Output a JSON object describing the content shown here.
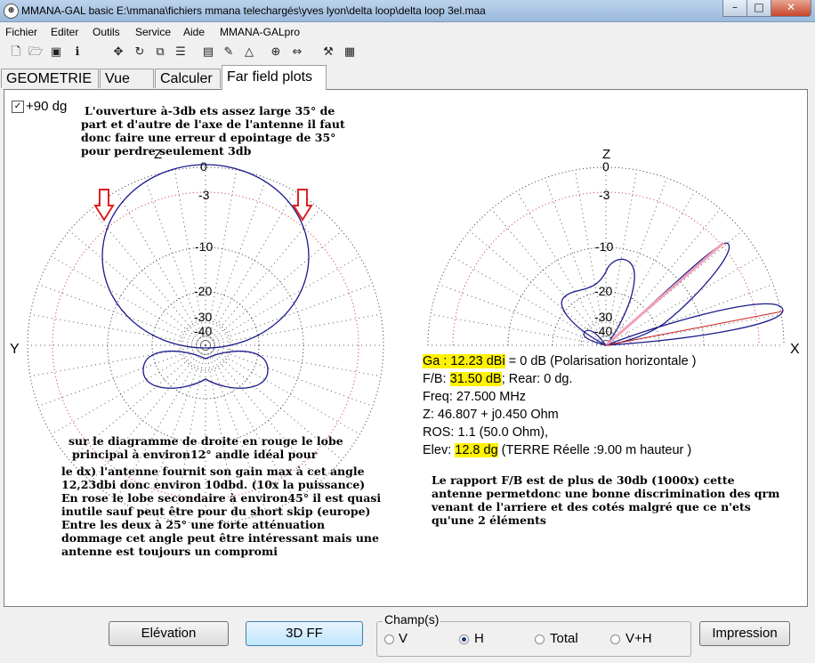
{
  "window": {
    "title": "MMANA-GAL basic E:\\mmana\\fichiers mmana telechargés\\yves lyon\\delta loop\\delta loop 3el.maa",
    "app_icon": "globe-icon",
    "min_icon": "minimize-icon",
    "max_icon": "maximize-icon",
    "close_icon": "close-icon"
  },
  "menu": [
    "Fichier",
    "Editer",
    "Outils",
    "Service",
    "Aide",
    "MMANA-GALpro"
  ],
  "toolbar_icons": [
    "new-file-icon",
    "open-folder-icon",
    "save-icon",
    "info-icon",
    "move-icon",
    "rotate-icon",
    "copy-icon",
    "sliders-icon",
    "document-icon",
    "pen-icon",
    "triangle-icon",
    "crosshair-icon",
    "arrows-icon",
    "tools-icon",
    "calculator-icon"
  ],
  "tabs": [
    "GEOMETRIE",
    "Vue",
    "Calculer",
    "Far field plots"
  ],
  "active_tab": "Far field plots",
  "checkbox": {
    "label": "+90 dg",
    "checked": true
  },
  "left_plot": {
    "axis_top": "Z",
    "axis_left": "Y",
    "db_labels": [
      "0",
      "-3",
      "-10",
      "-20",
      "-30",
      "-40"
    ],
    "pattern_color": "#1a1a8c",
    "arrow_color": "#e02020"
  },
  "right_plot": {
    "axis_top": "Z",
    "axis_right": "X",
    "db_labels": [
      "0",
      "-3",
      "-10",
      "-20",
      "-30",
      "-40"
    ],
    "pattern_color": "#1a1a8c",
    "main_lobe_line_color": "#cc2020",
    "secondary_lobe_line_color": "#f0a0b8"
  },
  "annotations": {
    "top_left": [
      "L'ouverture à-3db ets assez large  35° de",
      "part et d'autre de l'axe de l'antenne   il faut",
      "donc faire une erreur d epointage de 35°",
      "pour perdre seulement 3db"
    ],
    "bottom_left": [
      "sur le diagramme de droite en rouge le lobe",
      "principal à  environ12° andle idéal pour",
      "le dx) l'antenne fournit son gain max à cet angle",
      "12,23dbi donc environ 10dbd. (10x la puissance)",
      "En rose le lobe secondaire à environ45° il est quasi",
      "inutile sauf peut être pour du short skip (europe)",
      "Entre les deux à 25° une forte atténuation",
      "dommage cet angle peut être intéressant mais une",
      "antenne est toujours un compromi"
    ],
    "bottom_right": [
      "Le rapport F/B est de plus de 30db (1000x)  cette",
      "antenne permetdonc une bonne discrimination des qrm",
      "venant de l'arriere  et des cotés  malgré que ce n'ets",
      "qu'une 2 éléments"
    ]
  },
  "results": {
    "ga_label": "Ga : 12.23 dBi",
    "ga_rest": " = 0 dB  (Polarisation horizontale )",
    "fb_prefix": "F/B: ",
    "fb_value": "31.50 dB",
    "fb_rest": "; Rear: 0 dg.",
    "freq": "Freq: 27.500 MHz",
    "z": "Z: 46.807 + j0.450 Ohm",
    "ros": "ROS: 1.1 (50.0 Ohm),",
    "elev_prefix": "Elev: ",
    "elev_value": "12.8 dg",
    "elev_rest": " (TERRE Réelle    :9.00 m hauteur )"
  },
  "buttons": {
    "elevation": "Elévation",
    "ff3d": "3D FF",
    "print": "Impression"
  },
  "champ": {
    "label": "Champ(s)",
    "options": [
      "V",
      "H",
      "Total",
      "V+H"
    ],
    "selected": "H"
  }
}
